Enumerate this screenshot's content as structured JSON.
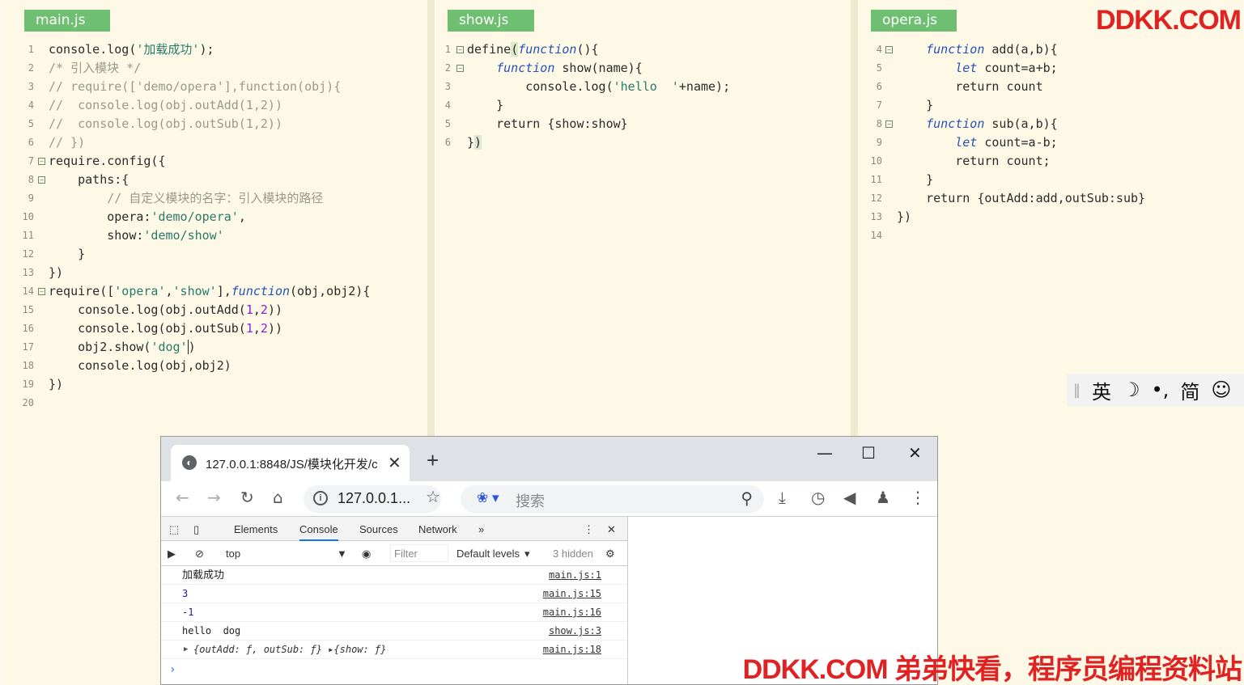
{
  "watermarks": {
    "top": "DDKK.COM",
    "bottom": "DDKK.COM 弟弟快看，程序员编程资料站"
  },
  "editor": {
    "panes": [
      {
        "tab": "main.js"
      },
      {
        "tab": "show.js"
      },
      {
        "tab": "opera.js"
      }
    ]
  },
  "ime": {
    "lang": "英",
    "moon": "☽",
    "punct": "•,",
    "script": "简",
    "emoji": "☺"
  },
  "browser": {
    "tab_title": "127.0.0.1:8848/JS/模块化开发/c",
    "url": "127.0.0.1...",
    "search_placeholder": "搜索",
    "devtools": {
      "tabs": [
        "Elements",
        "Console",
        "Sources",
        "Network"
      ],
      "context": "top",
      "filter_placeholder": "Filter",
      "levels": "Default levels",
      "hidden": "3 hidden",
      "logs": [
        {
          "msg": "加载成功",
          "src": "main.js:1"
        },
        {
          "msg": "3",
          "src": "main.js:15"
        },
        {
          "msg": "-1",
          "src": "main.js:16"
        },
        {
          "msg": "hello  dog",
          "src": "show.js:3"
        },
        {
          "msg": "{outAdd: ƒ, outSub: ƒ} ▸{show: ƒ}",
          "src": "main.js:18"
        }
      ]
    }
  }
}
